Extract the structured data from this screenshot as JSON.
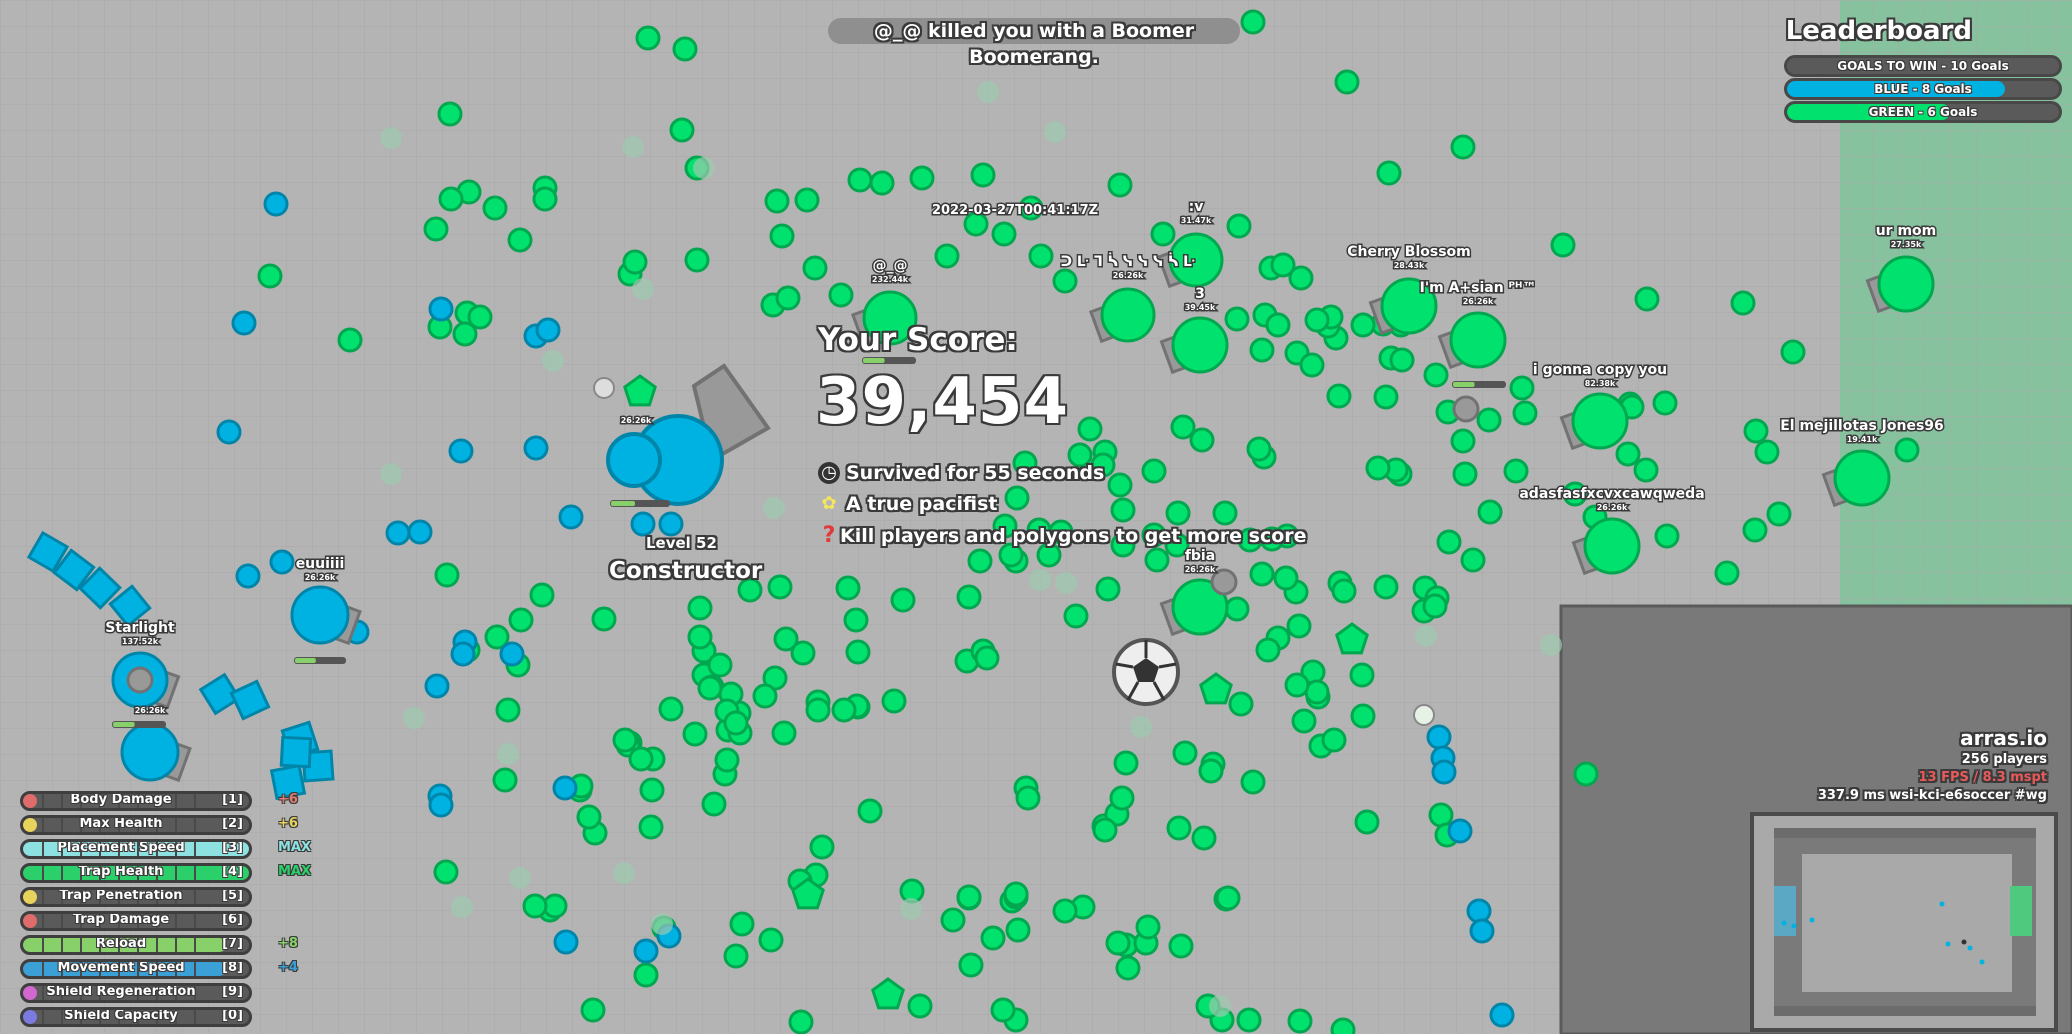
{
  "kill_message": "@_@ killed you with a Boomer Boomerang.",
  "leaderboard": {
    "title": "Leaderboard",
    "rows": [
      {
        "label": "GOALS TO WIN - 10 Goals",
        "fill": 1.0,
        "color": "#5a5a5a"
      },
      {
        "label": "BLUE - 8 Goals",
        "fill": 0.8,
        "color": "#00b2e1"
      },
      {
        "label": "GREEN - 6 Goals",
        "fill": 0.6,
        "color": "#00e16e"
      }
    ]
  },
  "death_screen": {
    "score_title": "Your Score:",
    "score_value": "39,454",
    "stats": [
      {
        "icon": "clock-icon",
        "glyph": "◷",
        "text": "Survived for 55 seconds"
      },
      {
        "icon": "flower-icon",
        "glyph": "✿",
        "text": "A true pacifist"
      },
      {
        "icon": "question-icon",
        "glyph": "?",
        "text": "Kill players and polygons to get more score"
      }
    ],
    "level": "Level 52",
    "tank_class": "Constructor"
  },
  "timestamp": "2022-03-27T00:41:17Z",
  "players": [
    {
      "name": "@_@",
      "score": "232.44k"
    },
    {
      "name": "Cherry Blossom",
      "score": "28.43k"
    },
    {
      "name": "I'm A+sian ᴾᴴ™",
      "score": "26.26k"
    },
    {
      "name": "ur mom",
      "score": "27.35k"
    },
    {
      "name": "i gonna copy you",
      "score": "82.38k"
    },
    {
      "name": "El mejillotas Jones96",
      "score": "19.41k"
    },
    {
      "name": "adasfasfxcvxcawqweda",
      "score": "26.26k"
    },
    {
      "name": "fbia",
      "score": "26.26k"
    },
    {
      "name": "euuiiii",
      "score": "26.26k"
    },
    {
      "name": "Starlight",
      "score": "137.52k"
    },
    {
      "name": "3",
      "score": "39.45k"
    },
    {
      "name": ":v",
      "score": "31.47k"
    },
    {
      "name": "ᑐ ᒷ ᒣ ᓵ ᓭ ᓭ ᓭ ᓵ ᒷ",
      "score": "26.26k"
    }
  ],
  "own_tank_score": "26.26k",
  "minor_score": "26.26k",
  "upgrades": [
    {
      "label": "Body Damage",
      "key": "[1]",
      "bonus": "+6",
      "color": "#e06b6b",
      "fill": 0.0,
      "bonus_color": "#e07b70"
    },
    {
      "label": "Max Health",
      "key": "[2]",
      "bonus": "+6",
      "color": "#e8d35c",
      "fill": 0.0,
      "bonus_color": "#e8d35c"
    },
    {
      "label": "Placement Speed",
      "key": "[3]",
      "bonus": "MAX",
      "color": "#8ee1e1",
      "fill": 1.0,
      "bonus_color": "#8ee1e1"
    },
    {
      "label": "Trap Health",
      "key": "[4]",
      "bonus": "MAX",
      "color": "#2bd06a",
      "fill": 1.0,
      "bonus_color": "#2bd06a"
    },
    {
      "label": "Trap Penetration",
      "key": "[5]",
      "bonus": "",
      "color": "#e8d35c",
      "fill": 0.06,
      "bonus_color": "#e8d35c"
    },
    {
      "label": "Trap Damage",
      "key": "[6]",
      "bonus": "",
      "color": "#e06b6b",
      "fill": 0.06,
      "bonus_color": "#e06b6b"
    },
    {
      "label": "Reload",
      "key": "[7]",
      "bonus": "+8",
      "color": "#88d06a",
      "fill": 0.9,
      "bonus_color": "#88d06a"
    },
    {
      "label": "Movement Speed",
      "key": "[8]",
      "bonus": "+4",
      "color": "#3aa0d6",
      "fill": 0.9,
      "bonus_color": "#3aa0d6"
    },
    {
      "label": "Shield Regeneration",
      "key": "[9]",
      "bonus": "",
      "color": "#d068d0",
      "fill": 0.06,
      "bonus_color": "#d068d0"
    },
    {
      "label": "Shield Capacity",
      "key": "[0]",
      "bonus": "",
      "color": "#7a7ae0",
      "fill": 0.06,
      "bonus_color": "#7a7ae0"
    }
  ],
  "server_info": {
    "game": "arras.io",
    "players": "256 players",
    "perf": "13 FPS / 8.3 mspt",
    "server": "337.9 ms  wsi-kci-e6soccer #wg"
  },
  "colors": {
    "blue_team": "#00b2e1",
    "green_team": "#00e16e",
    "barrel": "#999999",
    "background": "#b4b4b4"
  }
}
